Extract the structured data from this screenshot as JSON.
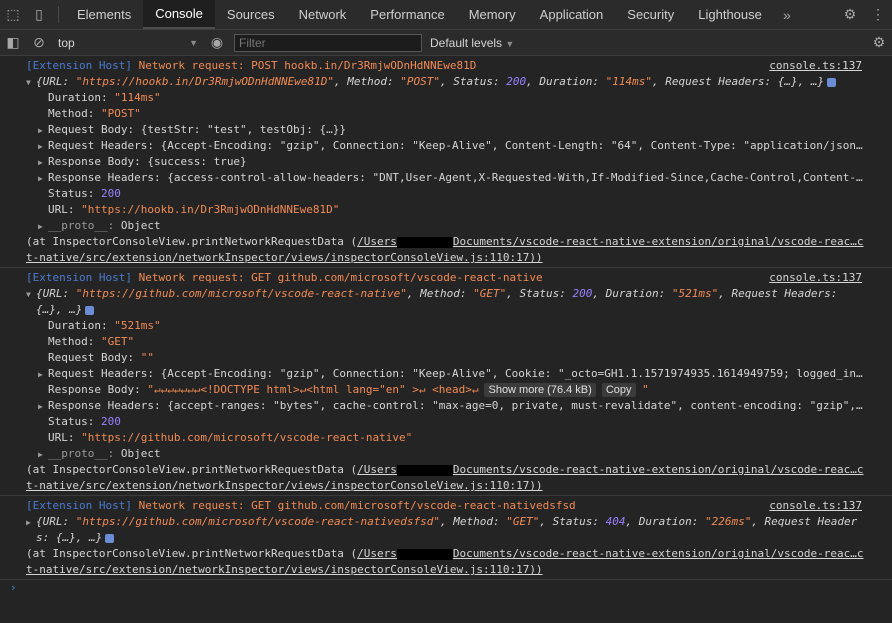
{
  "tabs": [
    "Elements",
    "Console",
    "Sources",
    "Network",
    "Performance",
    "Memory",
    "Application",
    "Security",
    "Lighthouse"
  ],
  "toolbar": {
    "context": "top",
    "filter_placeholder": "Filter",
    "levels": "Default levels"
  },
  "messages": [
    {
      "badge": "[Extension Host]",
      "summary": "Network request: POST hookb.in/Dr3RmjwODnHdNNEwe81D",
      "source": "console.ts:137",
      "object_line": {
        "url": "\"https://hookb.in/Dr3RmjwODnHdNNEwe81D\"",
        "method": "\"POST\"",
        "status": "200",
        "duration": "\"114ms\"",
        "tail": ", Request Headers: {…}, …}"
      },
      "props": [
        {
          "key": "Duration:",
          "val": "\"114ms\"",
          "type": "s",
          "exp": false
        },
        {
          "key": "Method:",
          "val": "\"POST\"",
          "type": "s",
          "exp": false
        },
        {
          "key": "Request Body:",
          "val": "{testStr: \"test\", testObj: {…}}",
          "type": "o",
          "exp": true
        },
        {
          "key": "Request Headers:",
          "val": "{Accept-Encoding: \"gzip\", Connection: \"Keep-Alive\", Content-Length: \"64\", Content-Type: \"application/json…",
          "type": "o",
          "exp": true
        },
        {
          "key": "Response Body:",
          "val": "{success: true}",
          "type": "o",
          "exp": true
        },
        {
          "key": "Response Headers:",
          "val": "{access-control-allow-headers: \"DNT,User-Agent,X-Requested-With,If-Modified-Since,Cache-Control,Content-…",
          "type": "o",
          "exp": true
        },
        {
          "key": "Status:",
          "val": "200",
          "type": "n",
          "exp": false
        },
        {
          "key": "URL:",
          "val": "\"https://hookb.in/Dr3RmjwODnHdNNEwe81D\"",
          "type": "s",
          "exp": false
        },
        {
          "key": "__proto__:",
          "val": "Object",
          "type": "p",
          "exp": true
        }
      ],
      "at_prefix": "(at InspectorConsoleView.printNetworkRequestData (",
      "at_path1": "/Users",
      "at_path2": "Documents/vscode-react-native-extension/original/vscode-reac…c",
      "at_line2": "t-native/src/extension/networkInspector/views/inspectorConsoleView.js:110:17))"
    },
    {
      "badge": "[Extension Host]",
      "summary": "Network request: GET github.com/microsoft/vscode-react-native",
      "source": "console.ts:137",
      "object_line": {
        "url": "\"https://github.com/microsoft/vscode-react-native\"",
        "method": "\"GET\"",
        "status": "200",
        "duration": "\"521ms\"",
        "tail": ", Request Headers:"
      },
      "object_line2": "{…}, …}",
      "props": [
        {
          "key": "Duration:",
          "val": "\"521ms\"",
          "type": "s",
          "exp": false
        },
        {
          "key": "Method:",
          "val": "\"GET\"",
          "type": "s",
          "exp": false
        },
        {
          "key": "Request Body:",
          "val": "\"\"",
          "type": "s",
          "exp": false
        },
        {
          "key": "Request Headers:",
          "val": "{Accept-Encoding: \"gzip\", Connection: \"Keep-Alive\", Cookie: \"_octo=GH1.1.1571974935.1614949759; logged_in…",
          "type": "o",
          "exp": true
        },
        {
          "key": "Response Body:",
          "val": "\"↵↵↵↵↵↵↵<!DOCTYPE html>↵<html lang=\"en\" >↵  <head>↵",
          "type": "s",
          "exp": false
        },
        {
          "key": "Response Headers:",
          "val": "{accept-ranges: \"bytes\", cache-control: \"max-age=0, private, must-revalidate\", content-encoding: \"gzip\",…",
          "type": "o",
          "exp": true
        },
        {
          "key": "Status:",
          "val": "200",
          "type": "n",
          "exp": false
        },
        {
          "key": "URL:",
          "val": "\"https://github.com/microsoft/vscode-react-native\"",
          "type": "s",
          "exp": false
        },
        {
          "key": "__proto__:",
          "val": "Object",
          "type": "p",
          "exp": true
        }
      ],
      "show_more": "Show more (76.4 kB)",
      "copy": "Copy",
      "at_prefix": "(at InspectorConsoleView.printNetworkRequestData (",
      "at_path1": "/Users",
      "at_path2": "Documents/vscode-react-native-extension/original/vscode-reac…c",
      "at_line2": "t-native/src/extension/networkInspector/views/inspectorConsoleView.js:110:17))"
    },
    {
      "badge": "[Extension Host]",
      "summary": "Network request: GET github.com/microsoft/vscode-react-nativedsfsd",
      "source": "console.ts:137",
      "object_line": {
        "url": "\"https://github.com/microsoft/vscode-react-nativedsfsd\"",
        "method": "\"GET\"",
        "status": "404",
        "duration": "\"226ms\"",
        "tail": ", Request Header"
      },
      "object_line2": "s: {…}, …}",
      "at_prefix": "(at InspectorConsoleView.printNetworkRequestData (",
      "at_path1": "/Users",
      "at_path2": "Documents/vscode-react-native-extension/original/vscode-reac…c",
      "at_line2": "t-native/src/extension/networkInspector/views/inspectorConsoleView.js:110:17))"
    }
  ],
  "prompt_symbol": "›"
}
